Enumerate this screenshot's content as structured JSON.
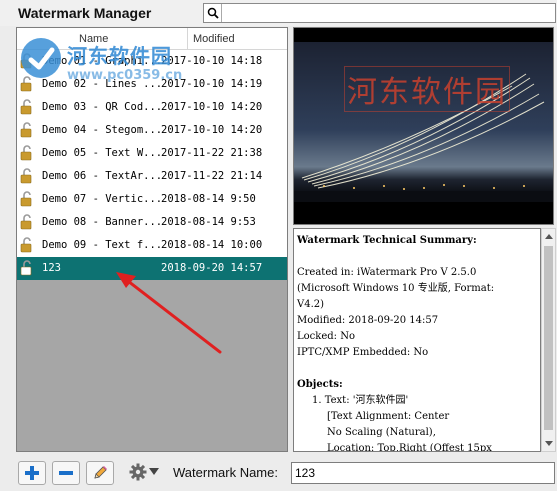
{
  "window": {
    "title": "Watermark Manager"
  },
  "search": {
    "value": "",
    "placeholder": ""
  },
  "overlay_logo": {
    "text": "河东软件园",
    "url": "www.pc0359.cn"
  },
  "list": {
    "columns": {
      "name": "Name",
      "modified": "Modified"
    },
    "rows": [
      {
        "name": "Demo 01 - Graphi...",
        "date": "2017-10-10 14:18",
        "selected": false
      },
      {
        "name": "Demo 02 - Lines ...",
        "date": "2017-10-10 14:19",
        "selected": false
      },
      {
        "name": "Demo 03 - QR Cod...",
        "date": "2017-10-10 14:20",
        "selected": false
      },
      {
        "name": "Demo 04 - Stegom...",
        "date": "2017-10-10 14:20",
        "selected": false
      },
      {
        "name": "Demo 05 - Text W...",
        "date": "2017-11-22 21:38",
        "selected": false
      },
      {
        "name": "Demo 06 - TextAr...",
        "date": "2017-11-22 21:14",
        "selected": false
      },
      {
        "name": "Demo 07 - Vertic...",
        "date": "2018-08-14 9:50",
        "selected": false
      },
      {
        "name": "Demo 08 - Banner...",
        "date": "2018-08-14 9:53",
        "selected": false
      },
      {
        "name": "Demo 09 - Text f...",
        "date": "2018-08-14 10:00",
        "selected": false
      },
      {
        "name": "123",
        "date": "2018-09-20 14:57",
        "selected": true
      }
    ]
  },
  "preview": {
    "watermark_text": "河东软件园"
  },
  "summary": {
    "heading": "Watermark Technical Summary:",
    "created": "Created in: iWatermark Pro V 2.5.0",
    "os_line1": "(Microsoft Windows 10 专业版, Format:",
    "os_line2": "V4.2)",
    "modified": "Modified: 2018-09-20 14:57",
    "locked": "Locked: No",
    "iptc": "IPTC/XMP Embedded: No",
    "objects_heading": "Objects:",
    "obj1": "1. Text: '河东软件园'",
    "obj_align": "[Text Alignment: Center",
    "obj_scaling": "No Scaling (Natural),",
    "obj_location": "Location: Top,Right (Offest 15px"
  },
  "toolbar": {
    "add_icon": "plus-icon",
    "remove_icon": "minus-icon",
    "edit_icon": "pencil-icon",
    "settings_icon": "gear-icon",
    "watermark_name_label": "Watermark Name:",
    "watermark_name_value": "123"
  },
  "colors": {
    "selection": "#0d7272",
    "add_button": "#1a6fc9",
    "remove_button": "#1a6fc9",
    "annotation_arrow": "#e02020",
    "watermark_text": "#c8412e"
  }
}
